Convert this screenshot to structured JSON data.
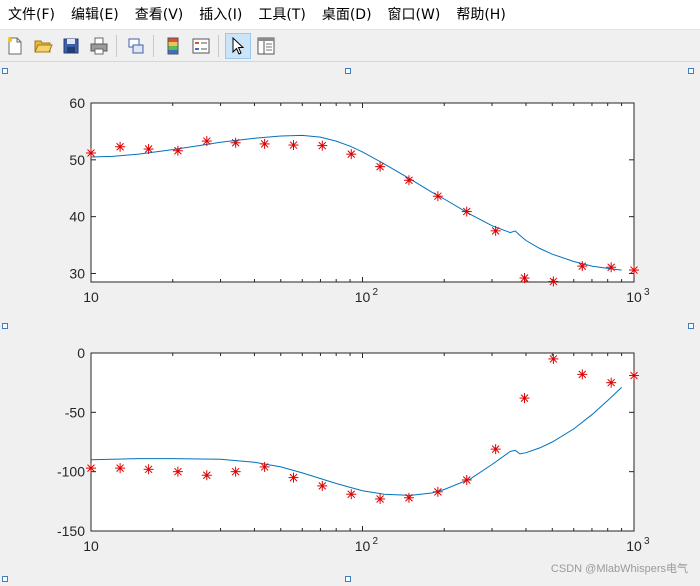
{
  "menu": [
    {
      "label": "文件(F)"
    },
    {
      "label": "编辑(E)"
    },
    {
      "label": "查看(V)"
    },
    {
      "label": "插入(I)"
    },
    {
      "label": "工具(T)"
    },
    {
      "label": "桌面(D)"
    },
    {
      "label": "窗口(W)"
    },
    {
      "label": "帮助(H)"
    }
  ],
  "toolbar": {
    "icons": [
      "new-figure-icon",
      "open-file-icon",
      "save-icon",
      "print-icon",
      "link-plot-icon",
      "insert-colorbar-icon",
      "insert-legend-icon",
      "edit-plot-icon",
      "property-inspector-icon"
    ],
    "active": "edit-plot-icon"
  },
  "watermark": "CSDN @MlabWhispers电气",
  "colors": {
    "line": "#0072bd",
    "marker": "#dd0000",
    "axis": "#262626",
    "selection_handle": "#3d7fc4"
  },
  "chart_data": [
    {
      "type": "line",
      "xscale": "log",
      "xlim": [
        10,
        1000
      ],
      "ylim": [
        28.5,
        60
      ],
      "yticks": [
        30,
        40,
        50,
        60
      ],
      "xticks": [
        10,
        100,
        1000
      ],
      "xtick_labels": [
        {
          "base": "10",
          "exp": ""
        },
        {
          "base": "10",
          "exp": "2"
        },
        {
          "base": "10",
          "exp": "3"
        }
      ],
      "title": "",
      "xlabel": "",
      "ylabel": "",
      "series": [
        {
          "style": "line",
          "x": [
            10,
            12,
            15,
            20,
            25,
            30,
            40,
            50,
            60,
            70,
            80,
            90,
            100,
            120,
            150,
            180,
            200,
            250,
            300,
            350,
            365,
            380,
            400,
            450,
            500,
            600,
            700,
            800,
            900
          ],
          "y": [
            50.5,
            50.6,
            51.0,
            51.8,
            52.5,
            53.1,
            53.8,
            54.2,
            54.3,
            54.0,
            53.3,
            52.4,
            51.4,
            49.3,
            46.6,
            44.3,
            43.1,
            40.4,
            38.4,
            37.2,
            37.5,
            36.7,
            35.8,
            34.4,
            33.4,
            32.1,
            31.3,
            30.9,
            30.6
          ]
        },
        {
          "style": "marker",
          "x": [
            10,
            12.8,
            16.3,
            20.9,
            26.7,
            34.1,
            43.6,
            55.7,
            71.1,
            90.9,
            116.1,
            148.3,
            189.5,
            242.1,
            309.3,
            395.1,
            504.8,
            644.9,
            823.9,
            1000
          ],
          "y": [
            51.2,
            52.3,
            51.9,
            51.6,
            53.3,
            53.0,
            52.8,
            52.6,
            52.5,
            51.0,
            48.8,
            46.4,
            43.6,
            40.9,
            37.5,
            29.2,
            28.6,
            31.3,
            31.1,
            30.6
          ]
        }
      ]
    },
    {
      "type": "line",
      "xscale": "log",
      "xlim": [
        10,
        1000
      ],
      "ylim": [
        -150,
        0
      ],
      "yticks": [
        -150,
        -100,
        -50,
        0
      ],
      "xticks": [
        10,
        100,
        1000
      ],
      "xtick_labels": [
        {
          "base": "10",
          "exp": ""
        },
        {
          "base": "10",
          "exp": "2"
        },
        {
          "base": "10",
          "exp": "3"
        }
      ],
      "title": "",
      "xlabel": "",
      "ylabel": "",
      "series": [
        {
          "style": "line",
          "x": [
            10,
            15,
            20,
            30,
            40,
            50,
            60,
            80,
            100,
            120,
            150,
            180,
            200,
            250,
            300,
            350,
            365,
            380,
            400,
            450,
            500,
            600,
            700,
            800,
            900
          ],
          "y": [
            -90,
            -89,
            -89,
            -89.5,
            -92,
            -96,
            -101,
            -110,
            -116,
            -119,
            -120,
            -118,
            -115,
            -106,
            -94,
            -83,
            -82,
            -85,
            -84,
            -80,
            -75,
            -64,
            -52,
            -40,
            -29
          ]
        },
        {
          "style": "marker",
          "x": [
            10,
            12.8,
            16.3,
            20.9,
            26.7,
            34.1,
            43.6,
            55.7,
            71.1,
            90.9,
            116.1,
            148.3,
            189.5,
            242.1,
            309.3,
            395.1,
            504.8,
            644.9,
            823.9,
            1000
          ],
          "y": [
            -97,
            -97,
            -98,
            -100,
            -103,
            -100,
            -96,
            -105,
            -112,
            -119,
            -123,
            -122,
            -117,
            -107,
            -81,
            -38,
            -5,
            -18,
            -25,
            -19
          ]
        }
      ]
    }
  ]
}
